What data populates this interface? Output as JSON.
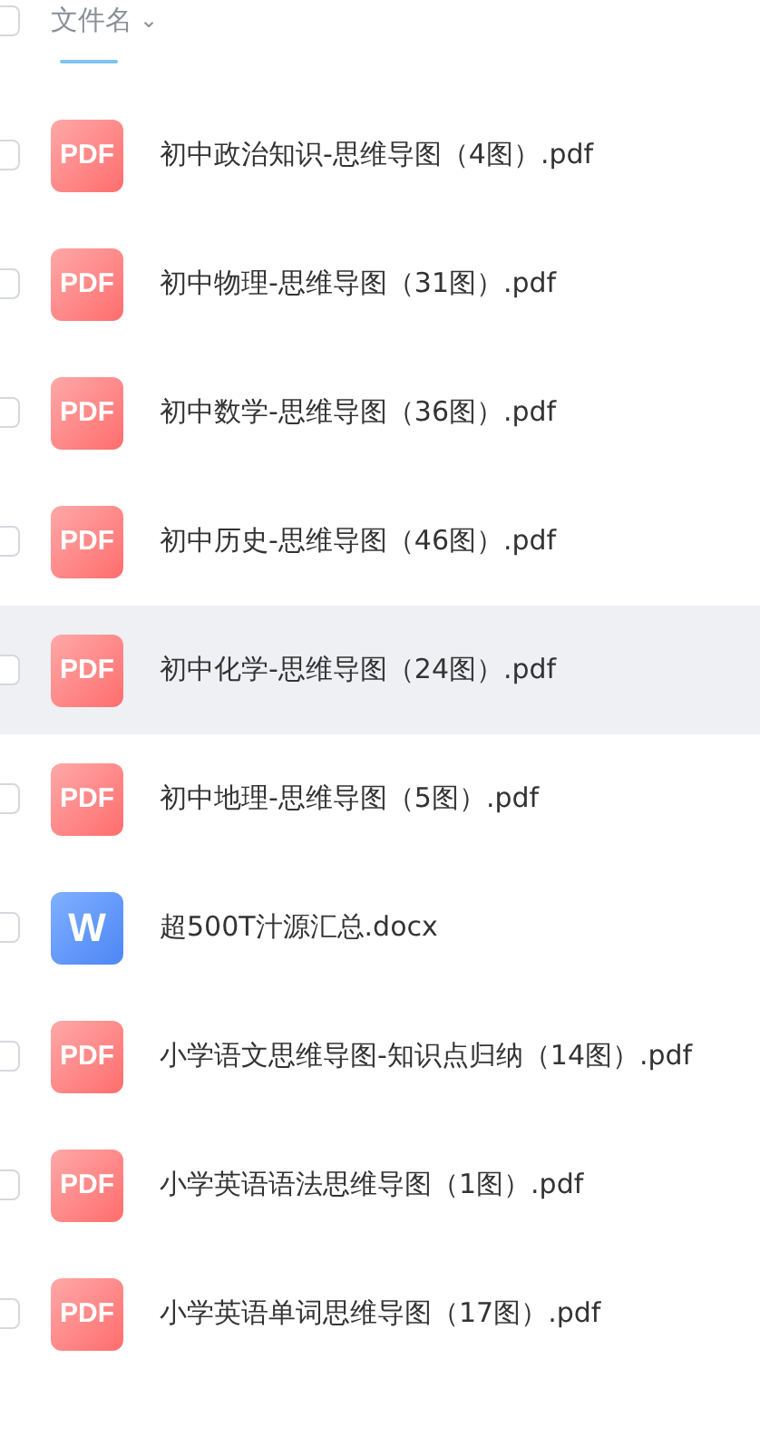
{
  "header": {
    "checked": false,
    "column_label": "文件名",
    "sort_indicator": "⌄"
  },
  "files": [
    {
      "kind": "pdf",
      "badge": "PDF",
      "name": "初中政治知识-思维导图（4图）.pdf",
      "checked": false,
      "highlighted": false
    },
    {
      "kind": "pdf",
      "badge": "PDF",
      "name": "初中物理-思维导图（31图）.pdf",
      "checked": false,
      "highlighted": false
    },
    {
      "kind": "pdf",
      "badge": "PDF",
      "name": "初中数学-思维导图（36图）.pdf",
      "checked": false,
      "highlighted": false
    },
    {
      "kind": "pdf",
      "badge": "PDF",
      "name": "初中历史-思维导图（46图）.pdf",
      "checked": false,
      "highlighted": false
    },
    {
      "kind": "pdf",
      "badge": "PDF",
      "name": "初中化学-思维导图（24图）.pdf",
      "checked": false,
      "highlighted": true
    },
    {
      "kind": "pdf",
      "badge": "PDF",
      "name": "初中地理-思维导图（5图）.pdf",
      "checked": false,
      "highlighted": false
    },
    {
      "kind": "word",
      "badge": "W",
      "name": "超500T汁源汇总.docx",
      "checked": false,
      "highlighted": false
    },
    {
      "kind": "pdf",
      "badge": "PDF",
      "name": "小学语文思维导图-知识点归纳（14图）.pdf",
      "checked": false,
      "highlighted": false
    },
    {
      "kind": "pdf",
      "badge": "PDF",
      "name": "小学英语语法思维导图（1图）.pdf",
      "checked": false,
      "highlighted": false
    },
    {
      "kind": "pdf",
      "badge": "PDF",
      "name": "小学英语单词思维导图（17图）.pdf",
      "checked": false,
      "highlighted": false
    }
  ]
}
